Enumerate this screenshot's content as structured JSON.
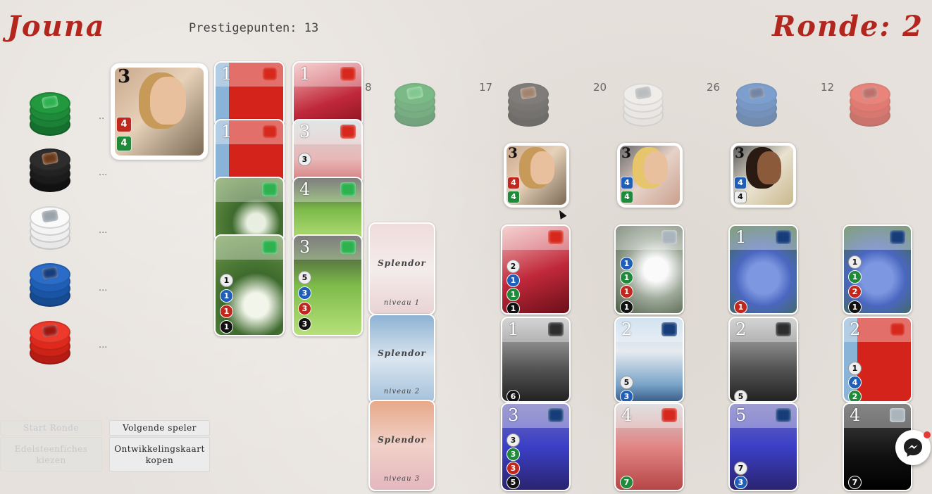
{
  "header": {
    "player_name": "Jouna",
    "prestige_label": "Prestigepunten:",
    "prestige_value": "13",
    "round_label": "Ronde:",
    "round_value": "2"
  },
  "colors": {
    "title_red": "#b3261e",
    "emerald": "#1e8a3a",
    "onyx": "#222222",
    "diamond": "#f4f4f4",
    "sapphire": "#1f5fb8",
    "ruby": "#e0281c"
  },
  "player_chips": [
    {
      "gem": "emerald",
      "icon": "emerald-chip-icon",
      "count": ".."
    },
    {
      "gem": "onyx",
      "icon": "onyx-chip-icon",
      "count": "..."
    },
    {
      "gem": "diamond",
      "icon": "diamond-chip-icon",
      "count": "..."
    },
    {
      "gem": "sapphire",
      "icon": "sapphire-chip-icon",
      "count": "..."
    },
    {
      "gem": "ruby",
      "icon": "ruby-chip-icon",
      "count": "..."
    }
  ],
  "player_reserved": {
    "points": "3",
    "cost": [
      "4",
      "4"
    ]
  },
  "supply_counts": {
    "emerald": "8",
    "onyx": "17",
    "diamond": "20",
    "sapphire": "26",
    "ruby": "12"
  },
  "nobles": [
    {
      "points": "3",
      "cost": [
        "4",
        "4"
      ]
    },
    {
      "points": "3",
      "cost": [
        "4",
        "4"
      ]
    },
    {
      "points": "3",
      "cost": [
        "4",
        "4"
      ]
    }
  ],
  "player_cards": {
    "col1": [
      {
        "points": "1",
        "costs": []
      },
      {
        "points": "1",
        "costs": []
      },
      {
        "points": "",
        "costs": []
      },
      {
        "points": "",
        "costs": [
          "1",
          "1",
          "1",
          "1"
        ]
      }
    ],
    "col2": [
      {
        "points": "1",
        "costs": []
      },
      {
        "points": "3",
        "costs": [
          "3"
        ]
      },
      {
        "points": "4",
        "costs": []
      },
      {
        "points": "3",
        "costs": [
          "5",
          "3",
          "3",
          "3"
        ]
      }
    ]
  },
  "decks": [
    {
      "title": "Splendor",
      "level": "niveau 1"
    },
    {
      "title": "Splendor",
      "level": "niveau 2"
    },
    {
      "title": "Splendor",
      "level": "niveau 3"
    }
  ],
  "market": {
    "row1": [
      {
        "points": "",
        "costs": [
          "2",
          "1",
          "1",
          "1"
        ]
      },
      {
        "points": "",
        "costs": [
          "1",
          "1",
          "1",
          "1"
        ]
      },
      {
        "points": "1",
        "costs": [
          "1"
        ]
      },
      {
        "points": "",
        "costs": [
          "1",
          "1",
          "2",
          "1"
        ]
      }
    ],
    "row2": [
      {
        "points": "1",
        "costs": [
          "6"
        ]
      },
      {
        "points": "2",
        "costs": [
          "5",
          "3"
        ]
      },
      {
        "points": "2",
        "costs": [
          "5"
        ]
      },
      {
        "points": "2",
        "costs": [
          "1",
          "4",
          "2"
        ]
      }
    ],
    "row3": [
      {
        "points": "3",
        "costs": [
          "3",
          "3",
          "3",
          "5"
        ]
      },
      {
        "points": "4",
        "costs": [
          "7"
        ]
      },
      {
        "points": "5",
        "costs": [
          "7",
          "3"
        ]
      },
      {
        "points": "4",
        "costs": [
          "7"
        ]
      }
    ]
  },
  "buttons": {
    "start_round": "Start Ronde",
    "next_player": "Volgende speler",
    "choose_gems": "Edelsteenfiches kiezen",
    "buy_card": "Ontwikkelingskaart kopen"
  }
}
